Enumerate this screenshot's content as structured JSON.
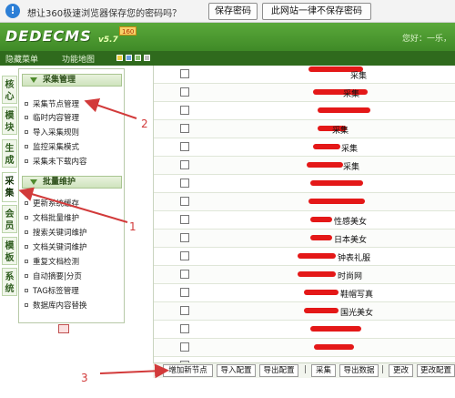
{
  "password_prompt": {
    "message": "想让360极速浏览器保存您的密码吗？",
    "save_label": "保存密码",
    "never_label": "此网站一律不保存密码"
  },
  "brand": {
    "logo": "DEDECMS",
    "version": "v5.7",
    "badge": "160",
    "user_text": "您好：一乐，"
  },
  "subbar": {
    "hide_menu": "隐藏菜单",
    "site_map": "功能地图"
  },
  "vtabs": [
    {
      "label": "核心"
    },
    {
      "label": "模块"
    },
    {
      "label": "生成"
    },
    {
      "label": "采集"
    },
    {
      "label": "会员"
    },
    {
      "label": "模板"
    },
    {
      "label": "系统"
    }
  ],
  "menu": {
    "collect_head": "采集管理",
    "collect_items": [
      "采集节点管理",
      "临时内容管理",
      "导入采集规则",
      "监控采集模式",
      "采集未下载内容"
    ],
    "batch_head": "批量维护",
    "batch_items": [
      "更新系统缓存",
      "文档批量维护",
      "搜索关键词维护",
      "文档关键词维护",
      "重复文档检测",
      "自动摘要|分页",
      "TAG标签管理",
      "数据库内容替换"
    ]
  },
  "rows": [
    {
      "name": "采集"
    },
    {
      "name": "采集"
    },
    {
      "name": ""
    },
    {
      "name": "采集"
    },
    {
      "name": "采集"
    },
    {
      "name": "采集"
    },
    {
      "name": ""
    },
    {
      "name": ""
    },
    {
      "name": "性感美女"
    },
    {
      "name": "日本美女"
    },
    {
      "name": "钟表礼服"
    },
    {
      "name": "时尚网"
    },
    {
      "name": "鞋帽写真"
    },
    {
      "name": "国光美女"
    },
    {
      "name": ""
    },
    {
      "name": ""
    },
    {
      "name": ""
    }
  ],
  "buttons": {
    "add_node": "增加新节点",
    "import_config": "导入配置",
    "export_config": "导出配置",
    "collect": "采集",
    "export_data": "导出数据",
    "edit": "更改",
    "change_config": "更改配置"
  },
  "annotations": {
    "one": "1",
    "two": "2",
    "three": "3"
  },
  "colors": {
    "brand_green": "#4a9a30",
    "annotation_red": "#d23a3a",
    "redaction_red": "#e41818"
  }
}
